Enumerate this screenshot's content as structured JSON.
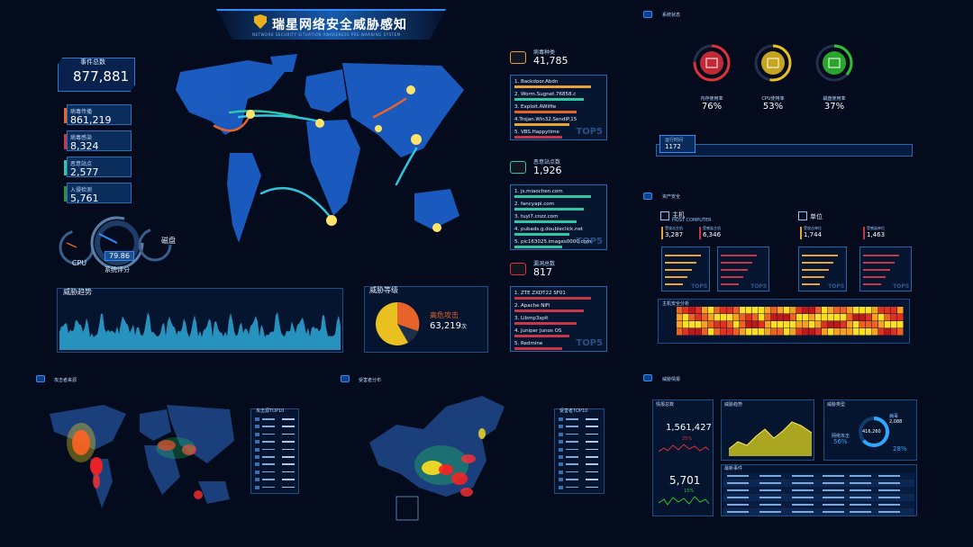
{
  "header": {
    "title": "瑞星网络安全威胁感知",
    "subtitle": "NETWORK SECURITY SITUATION AWARENESS PRE-WARNING SYSTEM"
  },
  "events": {
    "label": "事件总数",
    "total": "877,881",
    "items": [
      {
        "label": "病毒传播",
        "value": "861,219",
        "color": "#e8632a"
      },
      {
        "label": "病毒感染",
        "value": "8,324",
        "color": "#c8364a"
      },
      {
        "label": "恶意站点",
        "value": "2,577",
        "color": "#2fc7a4"
      },
      {
        "label": "入侵检测",
        "value": "5,761",
        "color": "#2f8f4a"
      }
    ]
  },
  "gauges": {
    "cpu_label": "CPU",
    "disk_label": "磁盘",
    "score_label": "系统评分",
    "score": "79.86"
  },
  "trend": {
    "label": "威胁趋势"
  },
  "threat_level": {
    "label": "威胁等级",
    "type": "高危攻击",
    "count": "63,219",
    "unit": "次"
  },
  "virus": {
    "label": "病毒种类",
    "total": "41,785",
    "tag": "TOP5",
    "items": [
      "1. Backdoor.Abdn",
      "2. Worm.Sugnet.76858.c",
      "3. Exploit.AWilfie",
      "4.Trojan.Win32.SendIP.15",
      "5. VBS.Happytime"
    ],
    "colors": [
      "#e8a23a",
      "#2fc7a4",
      "#e8632a",
      "#e8a23a",
      "#c8364a"
    ]
  },
  "malsites": {
    "label": "恶意站点数",
    "total": "1,926",
    "tag": "TOP5",
    "items": [
      "1. js.miaochen.com",
      "2. fancyapi.com",
      "3. tuyi7.cnzz.com",
      "4. pubads.g.doubleclick.net",
      "5. pic163025.images0000.com"
    ],
    "colors": [
      "#2fc7a4",
      "#2fc7a4",
      "#2fc7a4",
      "#2fc7a4",
      "#2fc7a4"
    ]
  },
  "vulns": {
    "label": "漏洞总数",
    "total": "817",
    "tag": "TOP5",
    "items": [
      "1. ZTE ZXDT22 SF01",
      "2. Apache NiFi",
      "3. Libmp3spit",
      "4. Juniper Junos OS",
      "5. Redmine"
    ],
    "colors": [
      "#c8364a",
      "#c8364a",
      "#c8364a",
      "#c8364a",
      "#c8364a"
    ]
  },
  "system": {
    "label": "系统状态",
    "rings": [
      {
        "name": "内存使用率",
        "value": "76%",
        "color": "#e0303a"
      },
      {
        "name": "CPU使用率",
        "value": "53%",
        "color": "#e8c020"
      },
      {
        "name": "磁盘使用率",
        "value": "37%",
        "color": "#30c030"
      }
    ],
    "uptime_label": "运行时间",
    "uptime": "1172"
  },
  "assets": {
    "label": "资产安全",
    "host_label": "主机",
    "host_sub": "HOST COMPUTER",
    "unit_label": "单位",
    "stats": [
      {
        "label": "受攻击主机",
        "value": "3,287",
        "color": "#e8a23a"
      },
      {
        "label": "受感染主机",
        "value": "6,346",
        "color": "#c8364a"
      },
      {
        "label": "受攻击单位",
        "value": "1,744",
        "color": "#e8a23a"
      },
      {
        "label": "受感染单位",
        "value": "1,463",
        "color": "#c8364a"
      }
    ],
    "tag": "TOP5",
    "heat_label": "主机安全分析"
  },
  "attack_source": {
    "label": "攻击者来源",
    "list_title": "攻击源TOP10"
  },
  "victim_dist": {
    "label": "受害者分布",
    "list_title": "受害者TOP10"
  },
  "threat_intel": {
    "label": "威胁情报",
    "intel_label": "情报总数",
    "big1": "1,561,427",
    "big1_pct": "25%",
    "big2": "5,701",
    "big2_pct": "15%",
    "trend_label": "威胁趋势",
    "type_label": "威胁类型",
    "ring_value": "416,260",
    "ring_a_label": "网络攻击",
    "ring_a_pct": "56%",
    "ring_b_label": "病毒",
    "ring_b_count": "2,088",
    "ring_b_pct": "28%",
    "events_label": "最新事件"
  },
  "colors": {
    "bg": "#030b1c",
    "accent": "#2f8cff",
    "panel_border": "#1d4f86"
  }
}
